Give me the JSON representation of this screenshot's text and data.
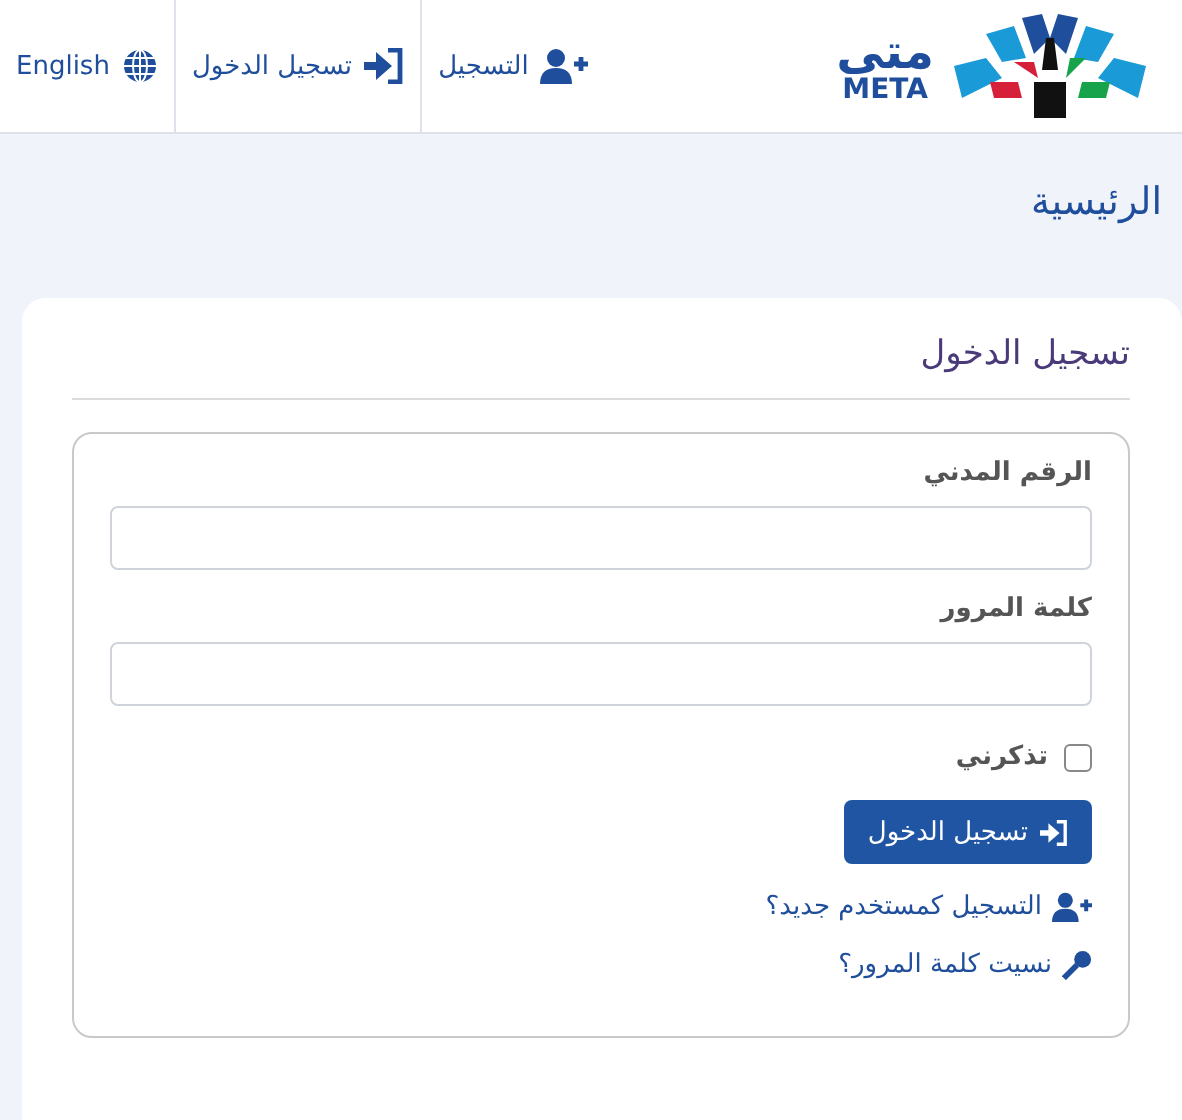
{
  "nav": {
    "logo": {
      "arabic": "متى",
      "latin": "META"
    },
    "links": [
      {
        "kind": "register",
        "label": "التسجيل"
      },
      {
        "kind": "login",
        "label": "تسجيل الدخول"
      },
      {
        "kind": "language",
        "label": "English"
      }
    ]
  },
  "breadcrumb": "الرئيسية",
  "card": {
    "title": "تسجيل الدخول",
    "fields": [
      {
        "label": "الرقم المدني"
      },
      {
        "label": "كلمة المرور"
      }
    ],
    "remember": {
      "label": "تذكرني",
      "checked": false
    },
    "submit": "تسجيل الدخول",
    "links": [
      {
        "kind": "register",
        "label": "التسجيل كمستخدم جديد؟"
      },
      {
        "kind": "key",
        "label": "نسيت كلمة المرور؟"
      }
    ]
  }
}
